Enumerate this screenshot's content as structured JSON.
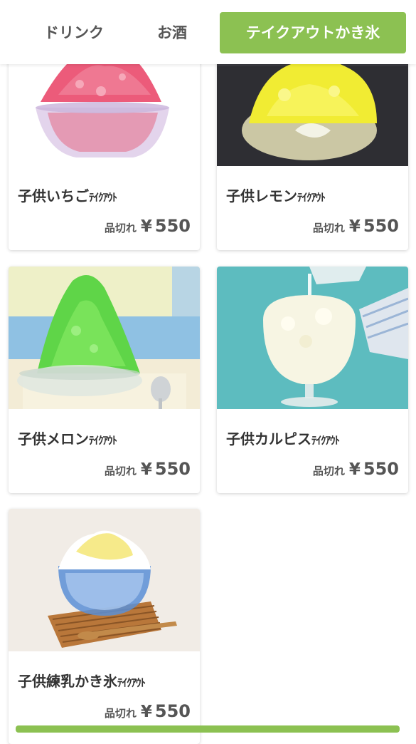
{
  "tabs": [
    {
      "label": "ドリンク",
      "active": false
    },
    {
      "label": "お酒",
      "active": false
    },
    {
      "label": "テイクアウトかき氷",
      "active": true
    }
  ],
  "products": [
    {
      "name": "子供いちご",
      "suffix": "ﾃｲｸｱｳﾄ",
      "status": "品切れ",
      "currency": "¥",
      "price": "550",
      "image": "strawberry-shaved-ice"
    },
    {
      "name": "子供レモン",
      "suffix": "ﾃｲｸｱｳﾄ",
      "status": "品切れ",
      "currency": "¥",
      "price": "550",
      "image": "lemon-shaved-ice"
    },
    {
      "name": "子供メロン",
      "suffix": "ﾃｲｸｱｳﾄ",
      "status": "品切れ",
      "currency": "¥",
      "price": "550",
      "image": "melon-shaved-ice"
    },
    {
      "name": "子供カルピス",
      "suffix": "ﾃｲｸｱｳﾄ",
      "status": "品切れ",
      "currency": "¥",
      "price": "550",
      "image": "calpis-shaved-ice"
    },
    {
      "name": "子供練乳かき氷",
      "suffix": "ﾃｲｸｱｳﾄ",
      "status": "品切れ",
      "currency": "¥",
      "price": "550",
      "image": "condensed-milk-shaved-ice"
    }
  ],
  "colors": {
    "accent": "#8cc152",
    "text": "#333333",
    "card_bg": "#ffffff"
  }
}
